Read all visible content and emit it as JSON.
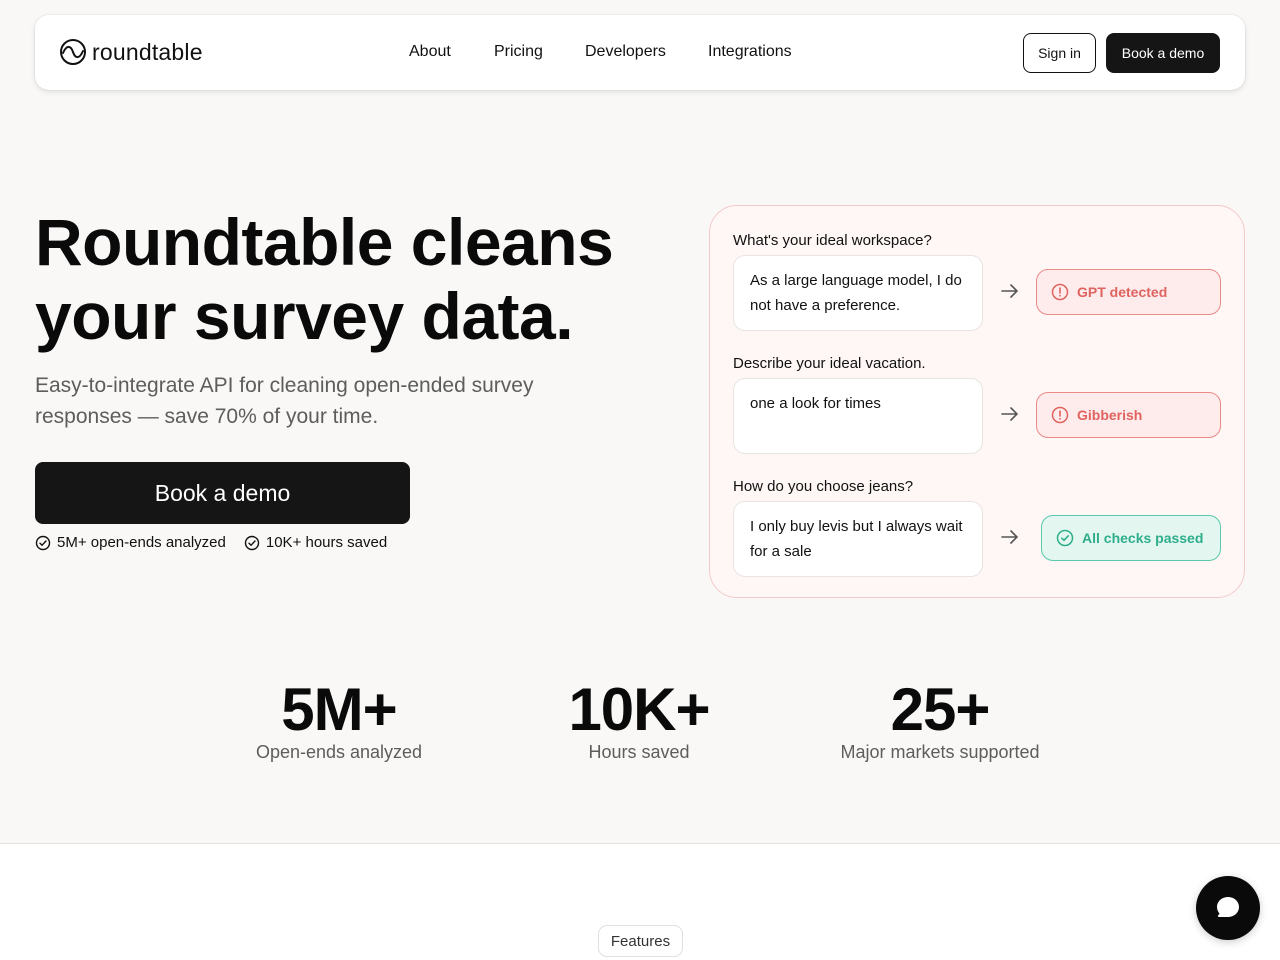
{
  "nav": {
    "logo_text": "roundtable",
    "links": [
      "About",
      "Pricing",
      "Developers",
      "Integrations"
    ],
    "sign_in": "Sign in",
    "book_demo": "Book a demo"
  },
  "hero": {
    "title_line1": "Roundtable cleans",
    "title_line2": "your survey data.",
    "subtitle": "Easy-to-integrate API for cleaning open-ended survey responses — save 70% of your time.",
    "cta": "Book a demo",
    "checks": [
      "5M+ open-ends analyzed",
      "10K+ hours saved"
    ]
  },
  "demo": {
    "items": [
      {
        "question": "What's your ideal workspace?",
        "answer": "As a large language model, I do not have a preference.",
        "result": "GPT detected",
        "status": "error"
      },
      {
        "question": "Describe your ideal vacation.",
        "answer": "one a look for times",
        "result": "Gibberish",
        "status": "error"
      },
      {
        "question": "How do you choose jeans?",
        "answer": "I only buy levis but I always wait for a sale",
        "result": "All checks passed",
        "status": "success"
      }
    ]
  },
  "stats": [
    {
      "value": "5M+",
      "label": "Open-ends analyzed"
    },
    {
      "value": "10K+",
      "label": "Hours saved"
    },
    {
      "value": "25+",
      "label": "Major markets supported"
    }
  ],
  "features": {
    "pill": "Features"
  },
  "colors": {
    "background": "#f9f8f6",
    "primary_button": "#151515",
    "error": "#e06360",
    "success": "#2fae8c",
    "card_border": "#f3caca"
  }
}
